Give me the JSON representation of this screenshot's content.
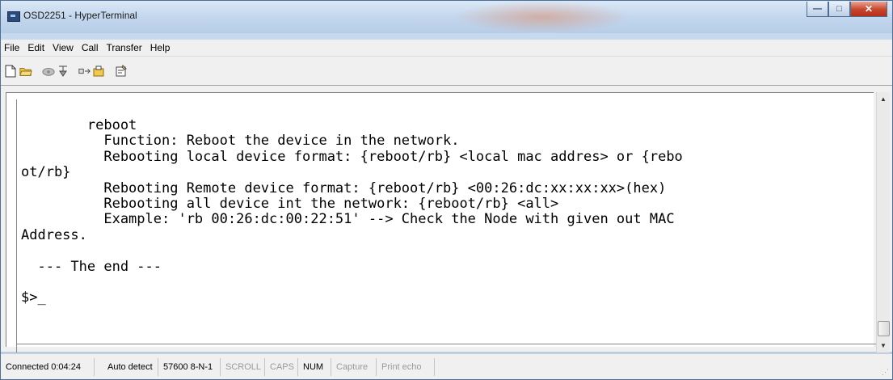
{
  "window": {
    "title": "OSD2251 - HyperTerminal",
    "buttons": {
      "minimize": "—",
      "maximize": "□",
      "close": "✕"
    }
  },
  "menu": {
    "items": [
      "File",
      "Edit",
      "View",
      "Call",
      "Transfer",
      "Help"
    ]
  },
  "toolbar": {
    "icons": [
      "new-document-icon",
      "open-folder-icon",
      "phone-connect-icon",
      "disconnect-icon",
      "send-icon",
      "receive-icon",
      "properties-icon"
    ]
  },
  "terminal": {
    "text": "        reboot\n          Function: Reboot the device in the network.\n          Rebooting local device format: {reboot/rb} <local mac addres> or {rebo\not/rb}\n          Rebooting Remote device format: {reboot/rb} <00:26:dc:xx:xx:xx>(hex)\n          Rebooting all device int the network: {reboot/rb} <all>\n          Example: 'rb 00:26:dc:00:22:51' --> Check the Node with given out MAC\nAddress.\n\n  --- The end ---\n\n$>_"
  },
  "status": {
    "connected": "Connected 0:04:24",
    "detect": "Auto detect",
    "baud": "57600 8-N-1",
    "scroll": "SCROLL",
    "caps": "CAPS",
    "num": "NUM",
    "capture": "Capture",
    "print_echo": "Print echo"
  }
}
